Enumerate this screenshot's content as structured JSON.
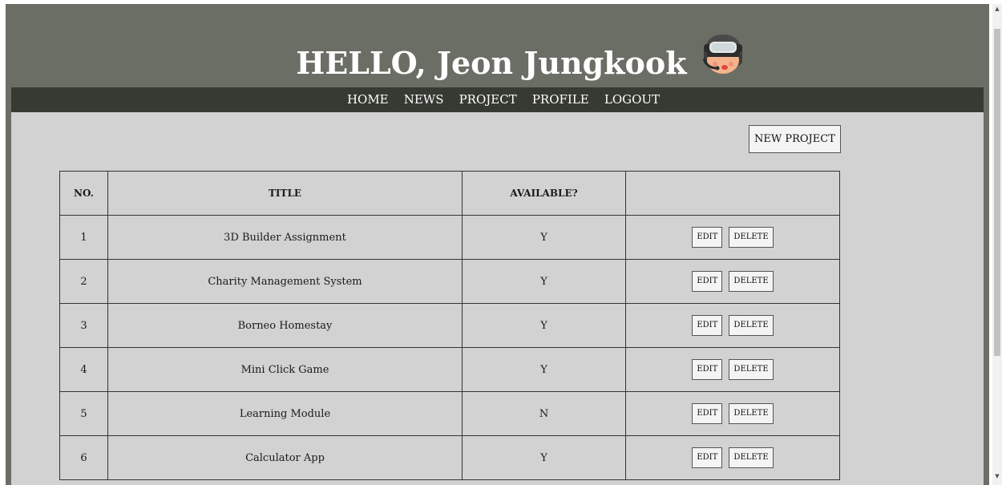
{
  "header": {
    "title": "HELLO, Jeon Jungkook",
    "avatar_icon": "pilot-avatar-icon"
  },
  "nav": {
    "items": [
      {
        "label": "HOME"
      },
      {
        "label": "NEWS"
      },
      {
        "label": "PROJECT"
      },
      {
        "label": "PROFILE"
      },
      {
        "label": "LOGOUT"
      }
    ]
  },
  "main": {
    "new_project_label": "NEW PROJECT",
    "table": {
      "columns": [
        "NO.",
        "TITLE",
        "AVAILABLE?",
        ""
      ],
      "rows": [
        {
          "no": "1",
          "title": "3D Builder Assignment",
          "available": "Y",
          "edit": "EDIT",
          "delete": "DELETE"
        },
        {
          "no": "2",
          "title": "Charity Management System",
          "available": "Y",
          "edit": "EDIT",
          "delete": "DELETE"
        },
        {
          "no": "3",
          "title": "Borneo Homestay",
          "available": "Y",
          "edit": "EDIT",
          "delete": "DELETE"
        },
        {
          "no": "4",
          "title": "Mini Click Game",
          "available": "Y",
          "edit": "EDIT",
          "delete": "DELETE"
        },
        {
          "no": "5",
          "title": "Learning Module",
          "available": "N",
          "edit": "EDIT",
          "delete": "DELETE"
        },
        {
          "no": "6",
          "title": "Calculator App",
          "available": "Y",
          "edit": "EDIT",
          "delete": "DELETE"
        }
      ]
    }
  },
  "colors": {
    "header_bg": "#6b6e65",
    "nav_bg": "#373a32",
    "content_bg": "#d2d2d2"
  }
}
